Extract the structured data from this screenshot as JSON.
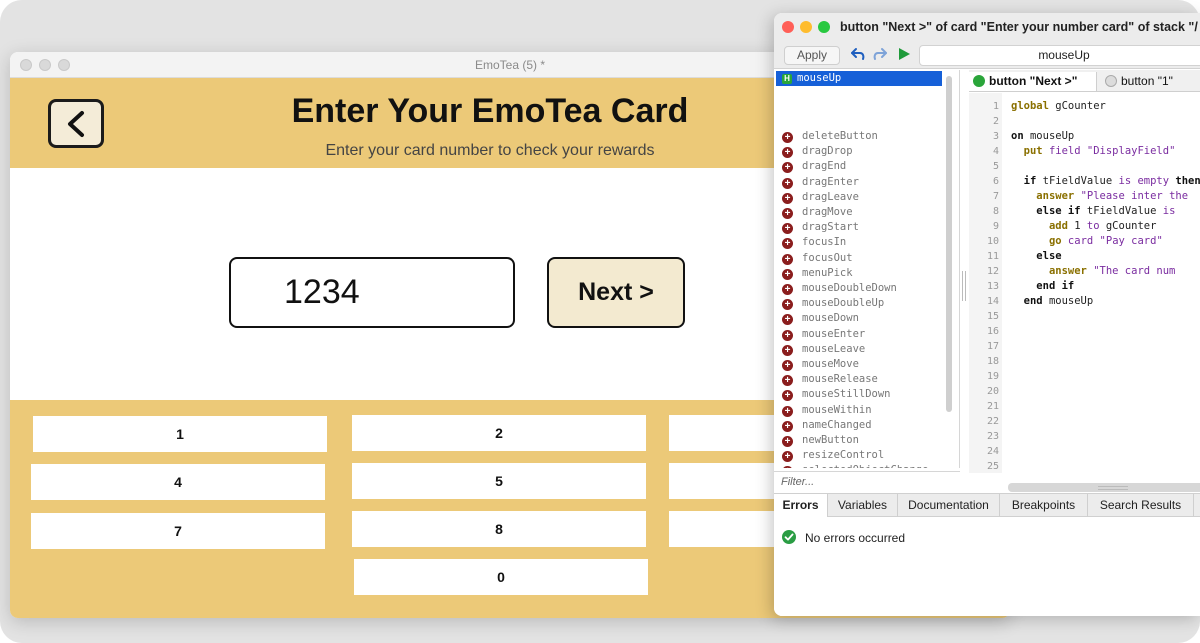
{
  "app": {
    "window_title": "EmoTea (5) *",
    "title": "Enter Your EmoTea Card",
    "subtitle": "Enter your card number to check your rewards",
    "card_number": "1234",
    "next_label": "Next >",
    "colors": {
      "header": "#ecc978",
      "keypad": "#ecc978",
      "next_bg": "#f3ead0"
    },
    "keys": [
      "1",
      "2",
      "4",
      "5",
      "7",
      "8",
      "0"
    ]
  },
  "editor": {
    "window_title": "button \"Next >\" of card \"Enter your number card\" of stack \"/",
    "apply_label": "Apply",
    "handler_name": "mouseUp",
    "selected_handler": "mouseUp",
    "messages": [
      "deleteButton",
      "dragDrop",
      "dragEnd",
      "dragEnter",
      "dragLeave",
      "dragMove",
      "dragStart",
      "focusIn",
      "focusOut",
      "menuPick",
      "mouseDoubleDown",
      "mouseDoubleUp",
      "mouseDown",
      "mouseEnter",
      "mouseLeave",
      "mouseMove",
      "mouseRelease",
      "mouseStillDown",
      "mouseWithin",
      "nameChanged",
      "newButton",
      "resizeControl",
      "selectedObjectChange"
    ],
    "filter_placeholder": "Filter...",
    "tabs": [
      "button \"Next >\"",
      "button \"1\""
    ],
    "line_numbers": [
      "1",
      "2",
      "3",
      "4",
      "5",
      "6",
      "7",
      "8",
      "9",
      "10",
      "11",
      "12",
      "13",
      "14",
      "15",
      "16",
      "17",
      "18",
      "19",
      "20",
      "21",
      "22",
      "23",
      "24",
      "25"
    ],
    "bottom_tabs": [
      "Errors",
      "Variables",
      "Documentation",
      "Breakpoints",
      "Search Results"
    ],
    "status": "No errors occurred"
  }
}
